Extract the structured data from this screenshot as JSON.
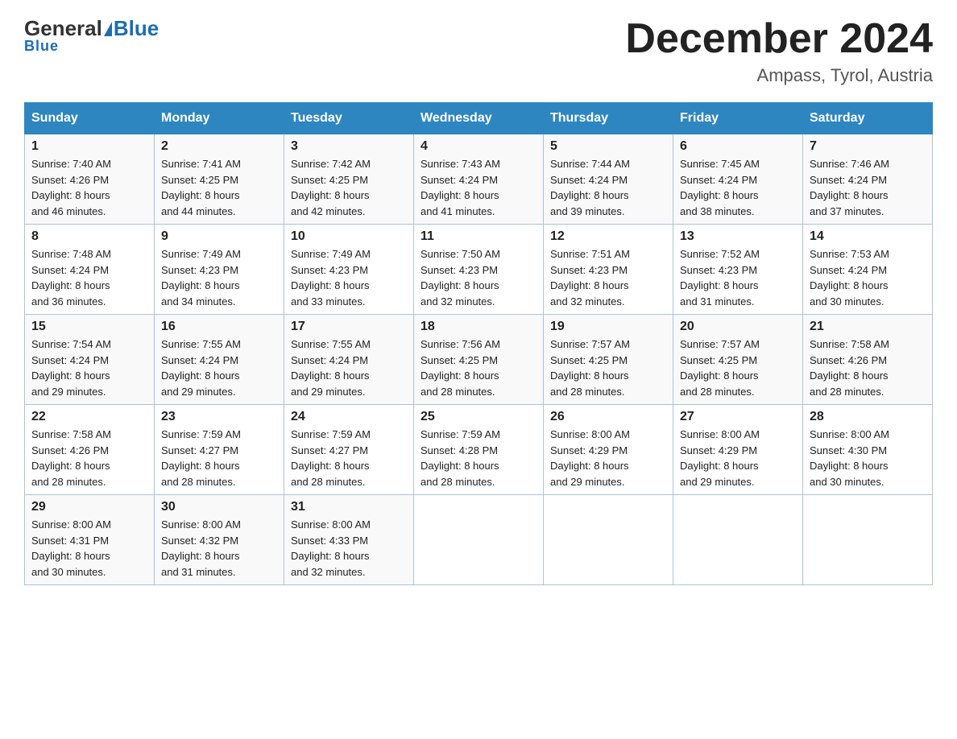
{
  "header": {
    "logo_general": "General",
    "logo_blue": "Blue",
    "month_title": "December 2024",
    "location": "Ampass, Tyrol, Austria"
  },
  "weekdays": [
    "Sunday",
    "Monday",
    "Tuesday",
    "Wednesday",
    "Thursday",
    "Friday",
    "Saturday"
  ],
  "weeks": [
    [
      {
        "day": "1",
        "sunrise": "7:40 AM",
        "sunset": "4:26 PM",
        "daylight": "8 hours and 46 minutes."
      },
      {
        "day": "2",
        "sunrise": "7:41 AM",
        "sunset": "4:25 PM",
        "daylight": "8 hours and 44 minutes."
      },
      {
        "day": "3",
        "sunrise": "7:42 AM",
        "sunset": "4:25 PM",
        "daylight": "8 hours and 42 minutes."
      },
      {
        "day": "4",
        "sunrise": "7:43 AM",
        "sunset": "4:24 PM",
        "daylight": "8 hours and 41 minutes."
      },
      {
        "day": "5",
        "sunrise": "7:44 AM",
        "sunset": "4:24 PM",
        "daylight": "8 hours and 39 minutes."
      },
      {
        "day": "6",
        "sunrise": "7:45 AM",
        "sunset": "4:24 PM",
        "daylight": "8 hours and 38 minutes."
      },
      {
        "day": "7",
        "sunrise": "7:46 AM",
        "sunset": "4:24 PM",
        "daylight": "8 hours and 37 minutes."
      }
    ],
    [
      {
        "day": "8",
        "sunrise": "7:48 AM",
        "sunset": "4:24 PM",
        "daylight": "8 hours and 36 minutes."
      },
      {
        "day": "9",
        "sunrise": "7:49 AM",
        "sunset": "4:23 PM",
        "daylight": "8 hours and 34 minutes."
      },
      {
        "day": "10",
        "sunrise": "7:49 AM",
        "sunset": "4:23 PM",
        "daylight": "8 hours and 33 minutes."
      },
      {
        "day": "11",
        "sunrise": "7:50 AM",
        "sunset": "4:23 PM",
        "daylight": "8 hours and 32 minutes."
      },
      {
        "day": "12",
        "sunrise": "7:51 AM",
        "sunset": "4:23 PM",
        "daylight": "8 hours and 32 minutes."
      },
      {
        "day": "13",
        "sunrise": "7:52 AM",
        "sunset": "4:23 PM",
        "daylight": "8 hours and 31 minutes."
      },
      {
        "day": "14",
        "sunrise": "7:53 AM",
        "sunset": "4:24 PM",
        "daylight": "8 hours and 30 minutes."
      }
    ],
    [
      {
        "day": "15",
        "sunrise": "7:54 AM",
        "sunset": "4:24 PM",
        "daylight": "8 hours and 29 minutes."
      },
      {
        "day": "16",
        "sunrise": "7:55 AM",
        "sunset": "4:24 PM",
        "daylight": "8 hours and 29 minutes."
      },
      {
        "day": "17",
        "sunrise": "7:55 AM",
        "sunset": "4:24 PM",
        "daylight": "8 hours and 29 minutes."
      },
      {
        "day": "18",
        "sunrise": "7:56 AM",
        "sunset": "4:25 PM",
        "daylight": "8 hours and 28 minutes."
      },
      {
        "day": "19",
        "sunrise": "7:57 AM",
        "sunset": "4:25 PM",
        "daylight": "8 hours and 28 minutes."
      },
      {
        "day": "20",
        "sunrise": "7:57 AM",
        "sunset": "4:25 PM",
        "daylight": "8 hours and 28 minutes."
      },
      {
        "day": "21",
        "sunrise": "7:58 AM",
        "sunset": "4:26 PM",
        "daylight": "8 hours and 28 minutes."
      }
    ],
    [
      {
        "day": "22",
        "sunrise": "7:58 AM",
        "sunset": "4:26 PM",
        "daylight": "8 hours and 28 minutes."
      },
      {
        "day": "23",
        "sunrise": "7:59 AM",
        "sunset": "4:27 PM",
        "daylight": "8 hours and 28 minutes."
      },
      {
        "day": "24",
        "sunrise": "7:59 AM",
        "sunset": "4:27 PM",
        "daylight": "8 hours and 28 minutes."
      },
      {
        "day": "25",
        "sunrise": "7:59 AM",
        "sunset": "4:28 PM",
        "daylight": "8 hours and 28 minutes."
      },
      {
        "day": "26",
        "sunrise": "8:00 AM",
        "sunset": "4:29 PM",
        "daylight": "8 hours and 29 minutes."
      },
      {
        "day": "27",
        "sunrise": "8:00 AM",
        "sunset": "4:29 PM",
        "daylight": "8 hours and 29 minutes."
      },
      {
        "day": "28",
        "sunrise": "8:00 AM",
        "sunset": "4:30 PM",
        "daylight": "8 hours and 30 minutes."
      }
    ],
    [
      {
        "day": "29",
        "sunrise": "8:00 AM",
        "sunset": "4:31 PM",
        "daylight": "8 hours and 30 minutes."
      },
      {
        "day": "30",
        "sunrise": "8:00 AM",
        "sunset": "4:32 PM",
        "daylight": "8 hours and 31 minutes."
      },
      {
        "day": "31",
        "sunrise": "8:00 AM",
        "sunset": "4:33 PM",
        "daylight": "8 hours and 32 minutes."
      },
      null,
      null,
      null,
      null
    ]
  ],
  "labels": {
    "sunrise": "Sunrise:",
    "sunset": "Sunset:",
    "daylight": "Daylight:"
  }
}
